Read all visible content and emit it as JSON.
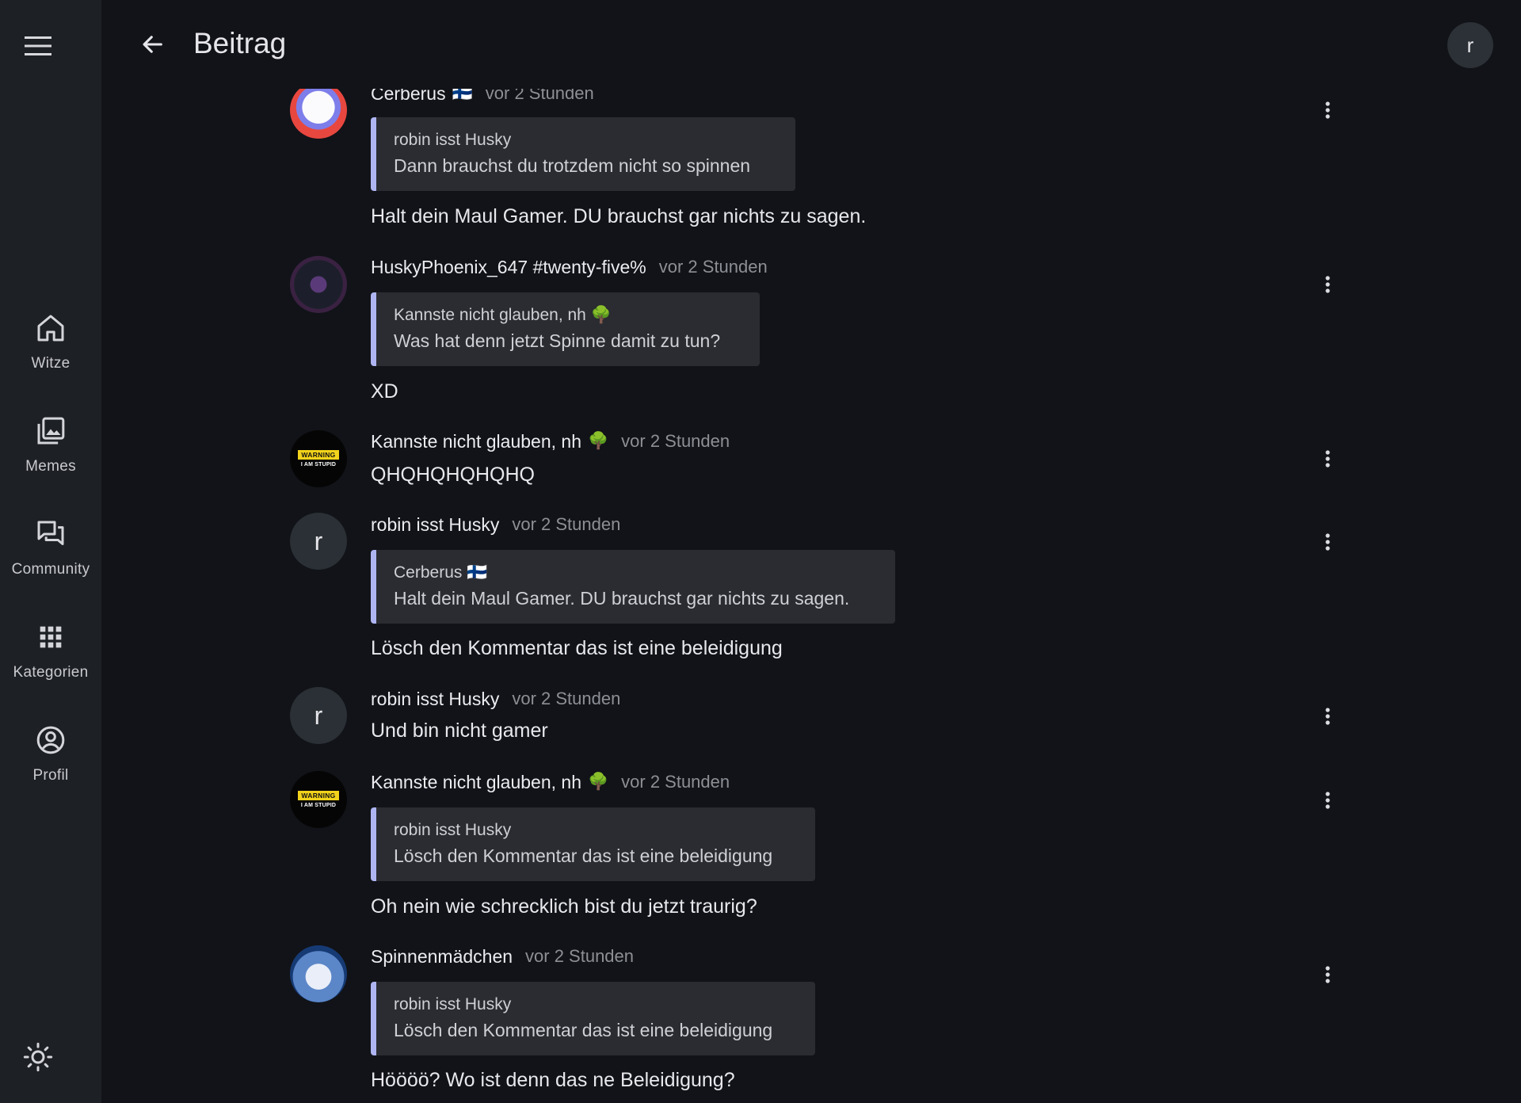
{
  "app": {
    "page_title": "Beitrag",
    "user_initial": "r"
  },
  "nav": {
    "items": [
      {
        "label": "Witze",
        "icon": "home-icon"
      },
      {
        "label": "Memes",
        "icon": "images-icon"
      },
      {
        "label": "Community",
        "icon": "forum-icon"
      },
      {
        "label": "Kategorien",
        "icon": "grid-icon"
      },
      {
        "label": "Profil",
        "icon": "account-circle-icon"
      }
    ],
    "theme_icon": "brightness-icon"
  },
  "colors": {
    "background": "#111318",
    "sidebar": "#1d2024",
    "quote_accent": "#aeb5f2",
    "muted_text": "#8d8f96"
  },
  "comments": [
    {
      "author": "Cerberus",
      "author_emoji": "🇫🇮",
      "time": "vor 2 Stunden",
      "quote": {
        "author": "robin isst Husky",
        "text": "Dann brauchst du trotzdem nicht so spinnen"
      },
      "text": "Halt dein Maul Gamer. DU brauchst gar nichts zu sagen."
    },
    {
      "author": "HuskyPhoenix_647 #twenty-five%",
      "time": "vor 2 Stunden",
      "quote": {
        "author": "Kannste nicht glauben, nh",
        "author_emoji": "🌳",
        "text": "Was hat denn jetzt Spinne damit zu tun?"
      },
      "text": "XD"
    },
    {
      "author": "Kannste nicht glauben, nh",
      "author_emoji": "🌳",
      "time": "vor 2 Stunden",
      "avatar_text": {
        "top": "WARNING",
        "bottom": "I AM STUPID"
      },
      "text": "QHQHQHQHQHQ"
    },
    {
      "author": "robin isst Husky",
      "time": "vor 2 Stunden",
      "avatar_letter": "r",
      "quote": {
        "author": "Cerberus",
        "author_emoji": "🇫🇮",
        "text": "Halt dein Maul Gamer. DU brauchst gar nichts zu sagen."
      },
      "text": "Lösch den Kommentar das ist eine beleidigung"
    },
    {
      "author": "robin isst Husky",
      "time": "vor 2 Stunden",
      "avatar_letter": "r",
      "text": "Und bin nicht gamer"
    },
    {
      "author": "Kannste nicht glauben, nh",
      "author_emoji": "🌳",
      "time": "vor 2 Stunden",
      "avatar_text": {
        "top": "WARNING",
        "bottom": "I AM STUPID"
      },
      "quote": {
        "author": "robin isst Husky",
        "text": "Lösch den Kommentar das ist eine beleidigung"
      },
      "text": "Oh nein wie schrecklich bist du jetzt traurig?"
    },
    {
      "author": "Spinnenmädchen",
      "time": "vor 2 Stunden",
      "quote": {
        "author": "robin isst Husky",
        "text": "Lösch den Kommentar das ist eine beleidigung"
      },
      "text": "Höööö? Wo ist denn das ne Beleidigung?"
    }
  ]
}
